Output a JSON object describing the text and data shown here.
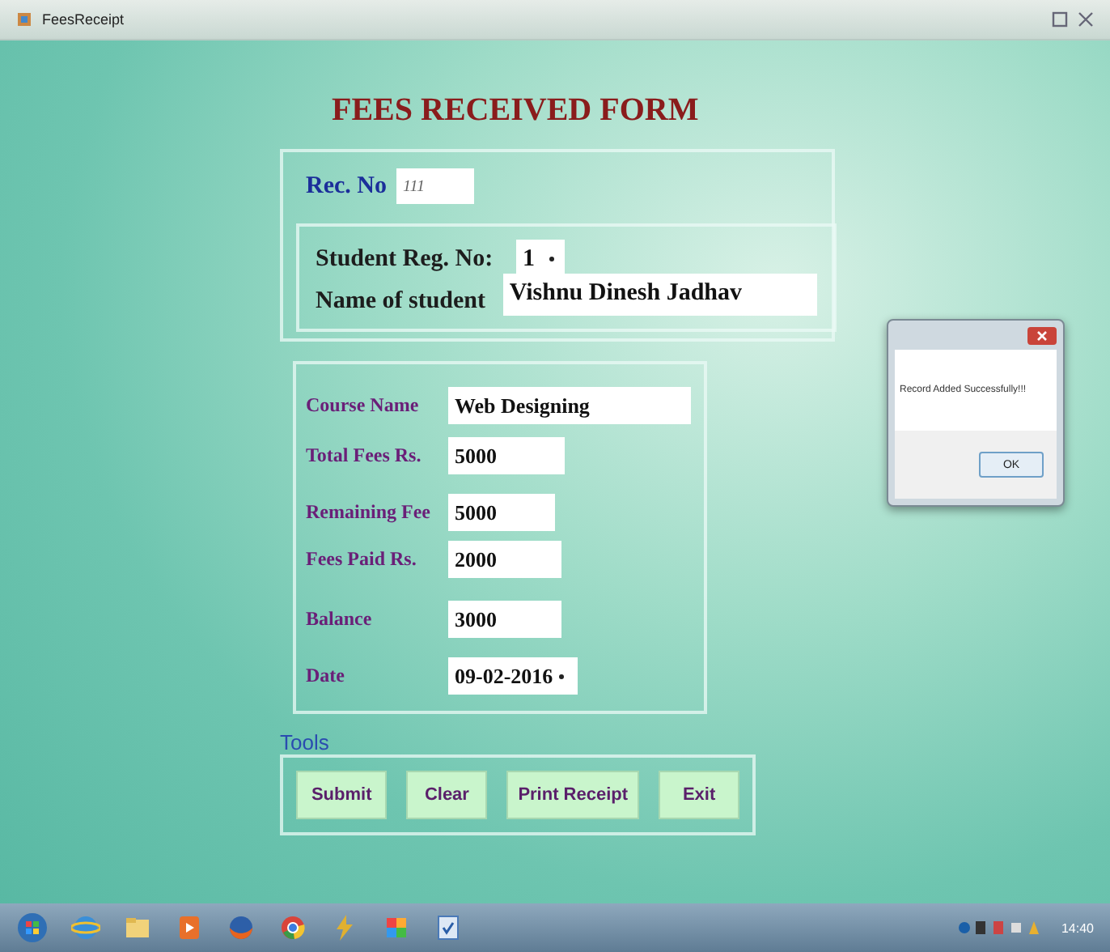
{
  "window": {
    "title": "FeesReceipt"
  },
  "form": {
    "heading": "FEES RECEIVED FORM",
    "rec_no": {
      "label": "Rec. No",
      "value": "111"
    },
    "student": {
      "reg_label": "Student Reg. No:",
      "reg_value": "1",
      "name_label": "Name of student",
      "name_value": "Vishnu Dinesh Jadhav"
    },
    "fees": [
      {
        "label": "Course Name",
        "value": "Web Designing",
        "kind": "text"
      },
      {
        "label": "Total Fees Rs.",
        "value": "5000",
        "kind": "text"
      },
      {
        "label": "Remaining Fee",
        "value": "5000",
        "kind": "text"
      },
      {
        "label": "Fees Paid Rs.",
        "value": "2000",
        "kind": "text"
      },
      {
        "label": "Balance",
        "value": "3000",
        "kind": "text"
      },
      {
        "label": "Date",
        "value": "09-02-2016",
        "kind": "date"
      }
    ],
    "tools": {
      "legend": "Tools",
      "buttons": [
        "Submit",
        "Clear",
        "Print Receipt",
        "Exit"
      ]
    }
  },
  "dialog": {
    "message": "Record Added Successfully!!!",
    "button": "OK"
  },
  "taskbar": {
    "clock": "14:40"
  }
}
